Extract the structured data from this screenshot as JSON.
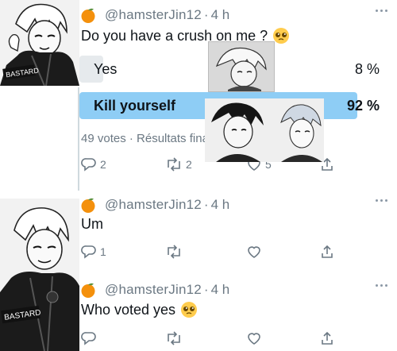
{
  "tweets": [
    {
      "handle": "@hamsterJin12",
      "separator": "·",
      "time": "4 h",
      "text": "Do you have a crush on me ?",
      "poll": {
        "options": [
          {
            "label": "Yes",
            "percent_text": "8 %",
            "percent": 8
          },
          {
            "label": "Kill yourself",
            "percent_text": "92 %",
            "percent": 92
          }
        ],
        "meta": "49 votes · Résultats finaux"
      },
      "actions": {
        "reply_count": "2",
        "retweet_count": "2",
        "like_count": "5"
      }
    },
    {
      "handle": "@hamsterJin12",
      "separator": "·",
      "time": "4 h",
      "text": "Um",
      "actions": {
        "reply_count": "1",
        "retweet_count": "",
        "like_count": ""
      }
    },
    {
      "handle": "@hamsterJin12",
      "separator": "·",
      "time": "4 h",
      "text": "Who voted yes",
      "actions": {
        "reply_count": "",
        "retweet_count": "",
        "like_count": ""
      }
    }
  ],
  "avatar_badge_text": "BASTARD",
  "colors": {
    "winning_bar": "#8ecdf5",
    "losing_bar": "#e6eaed",
    "muted_text": "#6b7883",
    "thread_line": "#cfd9de"
  },
  "icons": [
    "orange-emoji-icon",
    "pleading-face-icon",
    "reply-icon",
    "retweet-icon",
    "like-icon",
    "share-icon",
    "more-icon"
  ]
}
